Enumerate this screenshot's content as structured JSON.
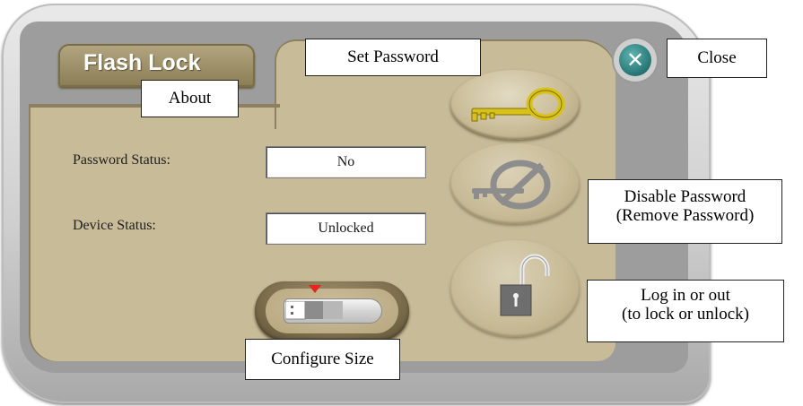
{
  "app": {
    "title": "Flash Lock"
  },
  "status": {
    "password_label": "Password Status:",
    "password_value": "No",
    "device_label": "Device Status:",
    "device_value": "Unlocked"
  },
  "buttons": {
    "close_symbol": "✕",
    "set_password_icon": "key-icon",
    "disable_password_icon": "disabled-key-icon",
    "lock_icon": "padlock-open-icon",
    "configure_size_icon": "usb-drive-icon"
  },
  "callouts": {
    "about": "About",
    "set_password": "Set Password",
    "close": "Close",
    "disable_password_line1": "Disable Password",
    "disable_password_line2": "(Remove Password)",
    "login_line1": "Log in or out",
    "login_line2": "(to lock or unlock)",
    "configure_size": "Configure Size"
  },
  "colors": {
    "panel_olive": "#c8bb98",
    "frame_grey": "#cfcfcf",
    "close_teal": "#2d7e7c",
    "key_gold": "#d8c21a",
    "marker_red": "#e5261c"
  }
}
